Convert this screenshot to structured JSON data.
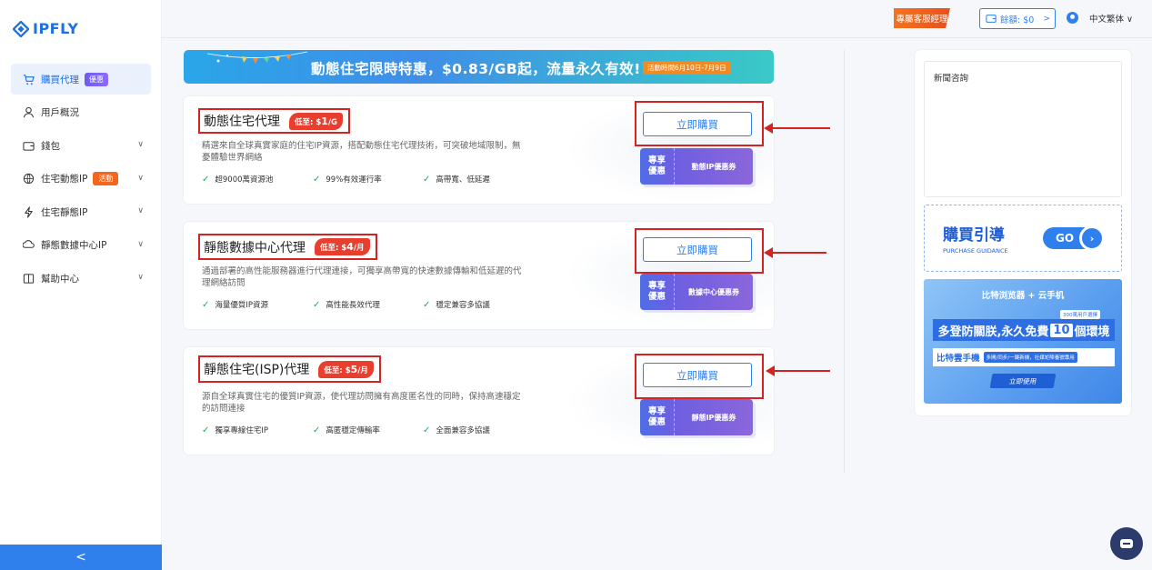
{
  "logo": {
    "text": "IPFLY"
  },
  "sidebar": {
    "items": [
      {
        "label": "購買代理",
        "badge": "優惠",
        "icon": "cart-icon"
      },
      {
        "label": "用戶概況",
        "icon": "user-icon"
      },
      {
        "label": "錢包",
        "icon": "wallet-icon"
      },
      {
        "label": "住宅動態IP",
        "badge": "活動",
        "icon": "globe-icon"
      },
      {
        "label": "住宅靜態IP",
        "icon": "bolt-icon"
      },
      {
        "label": "靜態數據中心IP",
        "icon": "datacenter-icon"
      },
      {
        "label": "幫助中心",
        "icon": "help-icon"
      }
    ],
    "collapse": "<"
  },
  "topbar": {
    "vip": "專屬客服經理",
    "balance": "餘額: $0",
    "balance_arrow": ">",
    "language": "中文繁体 ∨"
  },
  "banner": {
    "text": "動態住宅限時特惠，$0.83/GB起，流量永久有效!",
    "tag": "活動時間6月10日-7月9日"
  },
  "cards": [
    {
      "title": "動態住宅代理",
      "price_prefix": "低至: $",
      "price_value": "1",
      "price_unit": "/G",
      "desc": "精選來自全球真實家庭的住宅IP資源，搭配動態住宅代理技術，可突破地域限制，無憂體驗世界網絡",
      "features": [
        "超9000萬資源池",
        "99%有效運行率",
        "高帶寬、低延遲"
      ],
      "buy": "立即購買",
      "coupon_left": [
        "專享",
        "優惠"
      ],
      "coupon_right": "動態IP優惠券"
    },
    {
      "title": "靜態數據中心代理",
      "price_prefix": "低至: $",
      "price_value": "4",
      "price_unit": "/月",
      "desc": "通過部署的高性能服務器進行代理連接，可獨享高帶寬的快速數據傳輸和低延遲的代理網絡訪問",
      "features": [
        "海量優質IP資源",
        "高性能長效代理",
        "穩定兼容多協議"
      ],
      "buy": "立即購買",
      "coupon_left": [
        "專享",
        "優惠"
      ],
      "coupon_right": "數據中心優惠券"
    },
    {
      "title": "靜態住宅(ISP)代理",
      "price_prefix": "低至: $",
      "price_value": "5",
      "price_unit": "/月",
      "desc": "源自全球真實住宅的優質IP資源，使代理訪問擁有高度匿名性的同時，保持高速穩定的訪問連接",
      "features": [
        "獨享專線住宅IP",
        "高匿穩定傳輸率",
        "全面兼容多協議"
      ],
      "buy": "立即購買",
      "coupon_left": [
        "專享",
        "優惠"
      ],
      "coupon_right": "靜態IP優惠券"
    }
  ],
  "right": {
    "news_title": "新聞咨詢",
    "guide_title": "購買引導",
    "guide_sub": "PURCHASE GUIDANCE",
    "go": "GO",
    "ad_brand": "比特浏览器 + 云手机",
    "ad_small": "300萬用戶選擇",
    "ad_line1_a": "多登防關朕,永久免費",
    "ad_line1_num": "10",
    "ad_line1_b": "個環境",
    "ad_line2_name": "比特雲手機",
    "ad_line2_tag": "多開/同步/一鍵新機，社媒矩陣養號專用",
    "ad_cta": "立即使用"
  },
  "colors": {
    "accent": "#2f80ed",
    "annotation": "#d32323",
    "vip": "#f2661e"
  }
}
